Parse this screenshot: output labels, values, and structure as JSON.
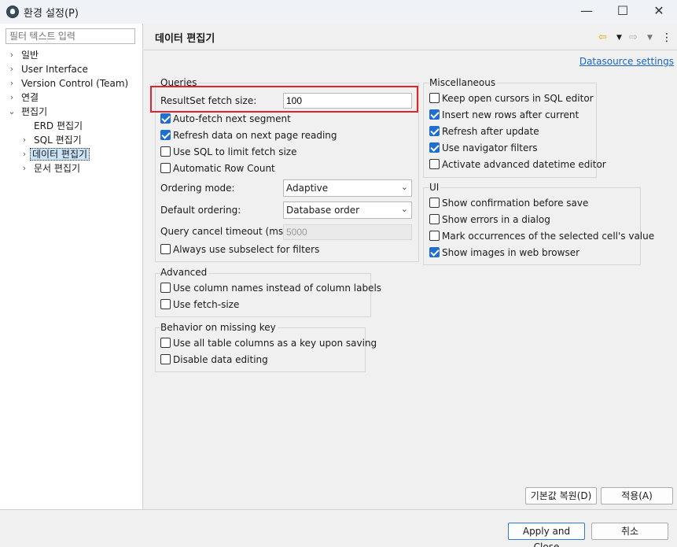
{
  "window": {
    "title": "환경 설정(P)",
    "minimize": "—",
    "maximize": "☐",
    "close": "✕"
  },
  "sidebar": {
    "filter_placeholder": "필터 텍스트 입력",
    "items": [
      {
        "label": "일반"
      },
      {
        "label": "User Interface"
      },
      {
        "label": "Version Control (Team)"
      },
      {
        "label": "연결"
      },
      {
        "label": "편집기"
      },
      {
        "label": "ERD 편집기"
      },
      {
        "label": "SQL 편집기"
      },
      {
        "label": "데이터 편집기"
      },
      {
        "label": "문서 편집기"
      }
    ]
  },
  "header": {
    "title": "데이터 편집기",
    "datasource_link": "Datasource settings"
  },
  "queries": {
    "group_title": "Queries",
    "fetch_size_label": "ResultSet fetch size:",
    "fetch_size_value": "100",
    "checkboxes": [
      {
        "label": "Auto-fetch next segment",
        "checked": true
      },
      {
        "label": "Refresh data on next page reading",
        "checked": true
      },
      {
        "label": "Use SQL to limit fetch size",
        "checked": false
      },
      {
        "label": "Automatic Row Count",
        "checked": false
      }
    ],
    "ordering_mode_label": "Ordering mode:",
    "ordering_mode_value": "Adaptive",
    "default_ordering_label": "Default ordering:",
    "default_ordering_value": "Database order",
    "cancel_timeout_label": "Query cancel timeout (ms):",
    "cancel_timeout_value": "5000",
    "subselect_label": "Always use subselect for filters",
    "subselect_checked": false
  },
  "advanced": {
    "group_title": "Advanced",
    "checkboxes": [
      {
        "label": "Use column names instead of column labels",
        "checked": false
      },
      {
        "label": "Use fetch-size",
        "checked": false
      }
    ]
  },
  "missing_key": {
    "group_title": "Behavior on missing key",
    "checkboxes": [
      {
        "label": "Use all table columns as a key upon saving",
        "checked": false
      },
      {
        "label": "Disable data editing",
        "checked": false
      }
    ]
  },
  "misc": {
    "group_title": "Miscellaneous",
    "checkboxes": [
      {
        "label": "Keep open cursors in SQL editor",
        "checked": false
      },
      {
        "label": "Insert new rows after current",
        "checked": true
      },
      {
        "label": "Refresh after update",
        "checked": true
      },
      {
        "label": "Use navigator filters",
        "checked": true
      },
      {
        "label": "Activate advanced datetime editor",
        "checked": false
      }
    ]
  },
  "ui": {
    "group_title": "UI",
    "checkboxes": [
      {
        "label": "Show confirmation before save",
        "checked": false
      },
      {
        "label": "Show errors in a dialog",
        "checked": false
      },
      {
        "label": "Mark occurrences of the selected cell's value",
        "checked": false
      },
      {
        "label": "Show images in web browser",
        "checked": true
      }
    ]
  },
  "buttons": {
    "restore_defaults": "기본값 복원(D)",
    "apply": "적용(A)",
    "apply_and_close": "Apply and Close",
    "cancel": "취소"
  },
  "colors": {
    "accent": "#1f6fd0",
    "highlight": "#e0242a",
    "link": "#1a64c8"
  }
}
